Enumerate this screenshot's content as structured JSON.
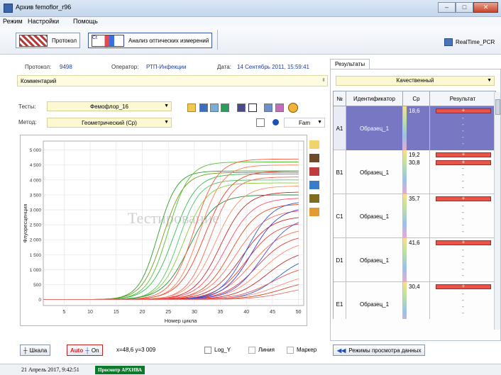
{
  "window": {
    "title": "Архив femoflor_r96",
    "close_glyph": "✕",
    "min_glyph": "–",
    "max_glyph": "□"
  },
  "menu": [
    "Режим",
    "Настройки",
    "Помощь"
  ],
  "toolbar": {
    "protocol_label": "Протокол",
    "analysis_label": "Анализ оптических измерений",
    "ct_icon_text": "Ct",
    "realtime_label": "RealTime_PCR"
  },
  "info": {
    "protocol_label": "Протокол:",
    "protocol_value": "9498",
    "operator_label": "Оператор:",
    "operator_value": "РТП-Инфекции",
    "date_label": "Дата:",
    "date_value": "14 Сентябрь 2011, 15:59:41"
  },
  "comment": {
    "label": "Комментарий",
    "value": ""
  },
  "tests": {
    "label": "Тесты:",
    "value": "Фемофлор_16"
  },
  "method": {
    "label": "Метод:",
    "value": "Геометрический (Cp)",
    "channel": "Fam"
  },
  "chart_data": {
    "type": "line",
    "xlabel": "Номер цикла",
    "ylabel": "Флуоресценция",
    "x_ticks": [
      5,
      10,
      15,
      20,
      25,
      30,
      35,
      40,
      45,
      50
    ],
    "y_ticks": [
      0,
      500,
      1000,
      1500,
      2000,
      2500,
      3000,
      3500,
      4000,
      4500,
      5000
    ],
    "y_tick_labels": [
      "0",
      "500",
      "1 000",
      "1 500",
      "2 000",
      "2 500",
      "3 000",
      "3 500",
      "4 000",
      "4 500",
      "5 000"
    ],
    "xlim": [
      1,
      51
    ],
    "ylim": [
      -200,
      5300
    ],
    "watermark": "Тестирование",
    "series": [
      {
        "color": "#2ca02c",
        "plateau": 4300,
        "mid": 23,
        "slope": 0.55
      },
      {
        "color": "#7a9a1a",
        "plateau": 4250,
        "mid": 24,
        "slope": 0.5
      },
      {
        "color": "#56c23a",
        "plateau": 4600,
        "mid": 25,
        "slope": 0.5
      },
      {
        "color": "#2fbf4a",
        "plateau": 4200,
        "mid": 26,
        "slope": 0.45
      },
      {
        "color": "#4fc76a",
        "plateau": 4000,
        "mid": 27,
        "slope": 0.5
      },
      {
        "color": "#8acb3a",
        "plateau": 3900,
        "mid": 28,
        "slope": 0.45
      },
      {
        "color": "#1e8f3a",
        "plateau": 3500,
        "mid": 29,
        "slope": 0.4
      },
      {
        "color": "#ff5a3c",
        "plateau": 4700,
        "mid": 30,
        "slope": 0.45
      },
      {
        "color": "#ff7f50",
        "plateau": 4500,
        "mid": 31,
        "slope": 0.45
      },
      {
        "color": "#e8452a",
        "plateau": 4300,
        "mid": 32,
        "slope": 0.4
      },
      {
        "color": "#f26b5b",
        "plateau": 4100,
        "mid": 33,
        "slope": 0.45
      },
      {
        "color": "#ff8c69",
        "plateau": 3800,
        "mid": 34,
        "slope": 0.4
      },
      {
        "color": "#d62728",
        "plateau": 3600,
        "mid": 35,
        "slope": 0.4
      },
      {
        "color": "#ff4d6d",
        "plateau": 3400,
        "mid": 36,
        "slope": 0.38
      },
      {
        "color": "#e64a19",
        "plateau": 3200,
        "mid": 37,
        "slope": 0.38
      },
      {
        "color": "#ff6f61",
        "plateau": 3000,
        "mid": 38,
        "slope": 0.35
      },
      {
        "color": "#cc2a2a",
        "plateau": 2800,
        "mid": 39,
        "slope": 0.35
      },
      {
        "color": "#f44336",
        "plateau": 2600,
        "mid": 40,
        "slope": 0.35
      },
      {
        "color": "#ff7043",
        "plateau": 2400,
        "mid": 41,
        "slope": 0.33
      },
      {
        "color": "#e53935",
        "plateau": 2200,
        "mid": 42,
        "slope": 0.33
      },
      {
        "color": "#ff8a65",
        "plateau": 2000,
        "mid": 43,
        "slope": 0.32
      },
      {
        "color": "#2e5bd6",
        "plateau": 3300,
        "mid": 40,
        "slope": 0.4
      },
      {
        "color": "#3a3ad0",
        "plateau": 3100,
        "mid": 41,
        "slope": 0.38
      },
      {
        "color": "#5050e0",
        "plateau": 2800,
        "mid": 43,
        "slope": 0.35
      },
      {
        "color": "#2266cc",
        "plateau": 1500,
        "mid": 46,
        "slope": 0.35
      },
      {
        "color": "#c62828",
        "plateau": 1700,
        "mid": 44,
        "slope": 0.32
      },
      {
        "color": "#ef5350",
        "plateau": 1200,
        "mid": 45,
        "slope": 0.3
      },
      {
        "color": "#ff8f80",
        "plateau": 900,
        "mid": 46,
        "slope": 0.3
      },
      {
        "color": "#d84315",
        "plateau": 700,
        "mid": 47,
        "slope": 0.3
      },
      {
        "color": "#e57373",
        "plateau": 500,
        "mid": 48,
        "slope": 0.3
      }
    ]
  },
  "bottom": {
    "scale_label": "Шкала",
    "auto_label": "Auto",
    "on_label": "On",
    "coords": "x=48,6 y=3 009",
    "logy_label": "Log_Y",
    "line_label": "Линия",
    "marker_label": "Маркер",
    "view_modes_label": "Режимы просмотра данных"
  },
  "status": {
    "datetime": "21 Апрель 2017, 9:42:51",
    "badge": "Просмотр АРХИВА"
  },
  "results": {
    "tab_label": "Результаты",
    "mode": "Качественный",
    "headers": [
      "№",
      "Идентификатор",
      "Cp",
      "Результат"
    ],
    "rows": [
      {
        "no": "A1",
        "id": "Образец_1",
        "cps": [
          "18,6"
        ],
        "selected": true
      },
      {
        "no": "B1",
        "id": "Образец_1",
        "cps": [
          "19,2",
          "30,8"
        ],
        "selected": false
      },
      {
        "no": "C1",
        "id": "Образец_1",
        "cps": [
          "35,7"
        ],
        "selected": false
      },
      {
        "no": "D1",
        "id": "Образец_1",
        "cps": [
          "41,6"
        ],
        "selected": false
      },
      {
        "no": "E1",
        "id": "Образец_1",
        "cps": [
          "30,4"
        ],
        "selected": false
      }
    ],
    "plus": "+",
    "minus": "-"
  }
}
